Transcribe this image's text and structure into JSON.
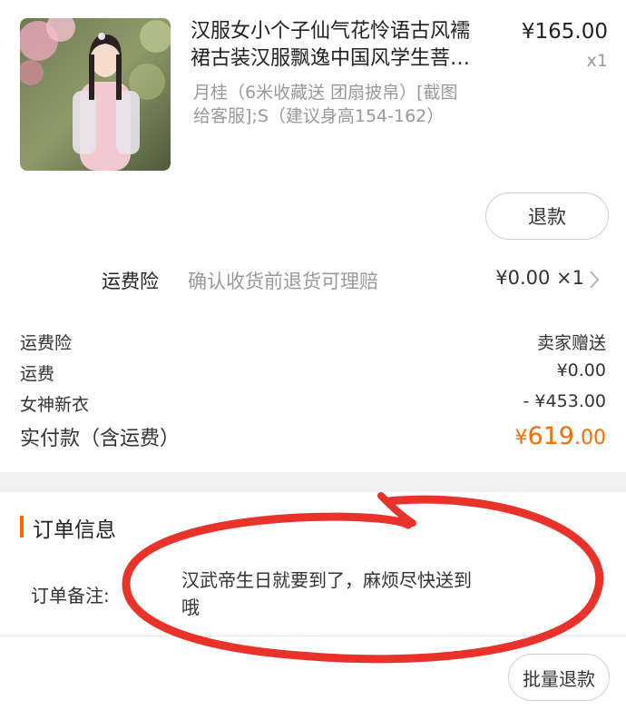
{
  "product": {
    "title_line1": "汉服女小个子仙气花怜语古风襦",
    "title_line2": "裙古装汉服飘逸中国风学生菩…",
    "sku_line1": "月桂（6米收藏送 团扇披帛）[截图",
    "sku_line2": "给客服];S（建议身高154-162）",
    "price": "¥165.00",
    "quantity": "x1",
    "refund_label": "退款"
  },
  "insurance": {
    "label": "运费险",
    "description": "确认收货前退货可理赔",
    "price": "¥0.00 ×1"
  },
  "summary": {
    "rows": [
      {
        "label": "运费险",
        "value": "卖家赠送"
      },
      {
        "label": "运费",
        "value": "¥0.00"
      },
      {
        "label": "女神新衣",
        "value": "- ¥453.00"
      }
    ],
    "total_label": "实付款（含运费）",
    "total_currency": "¥",
    "total_integer": "619",
    "total_decimal": ".00"
  },
  "order_info": {
    "title": "订单信息",
    "note_label": "订单备注:",
    "note_text_line1": "汉武帝生日就要到了，麻烦尽快送到",
    "note_text_line2": "哦"
  },
  "footer": {
    "batch_refund_label": "批量退款"
  },
  "colors": {
    "accent": "#ff6a00",
    "annotation": "#e8322a"
  }
}
